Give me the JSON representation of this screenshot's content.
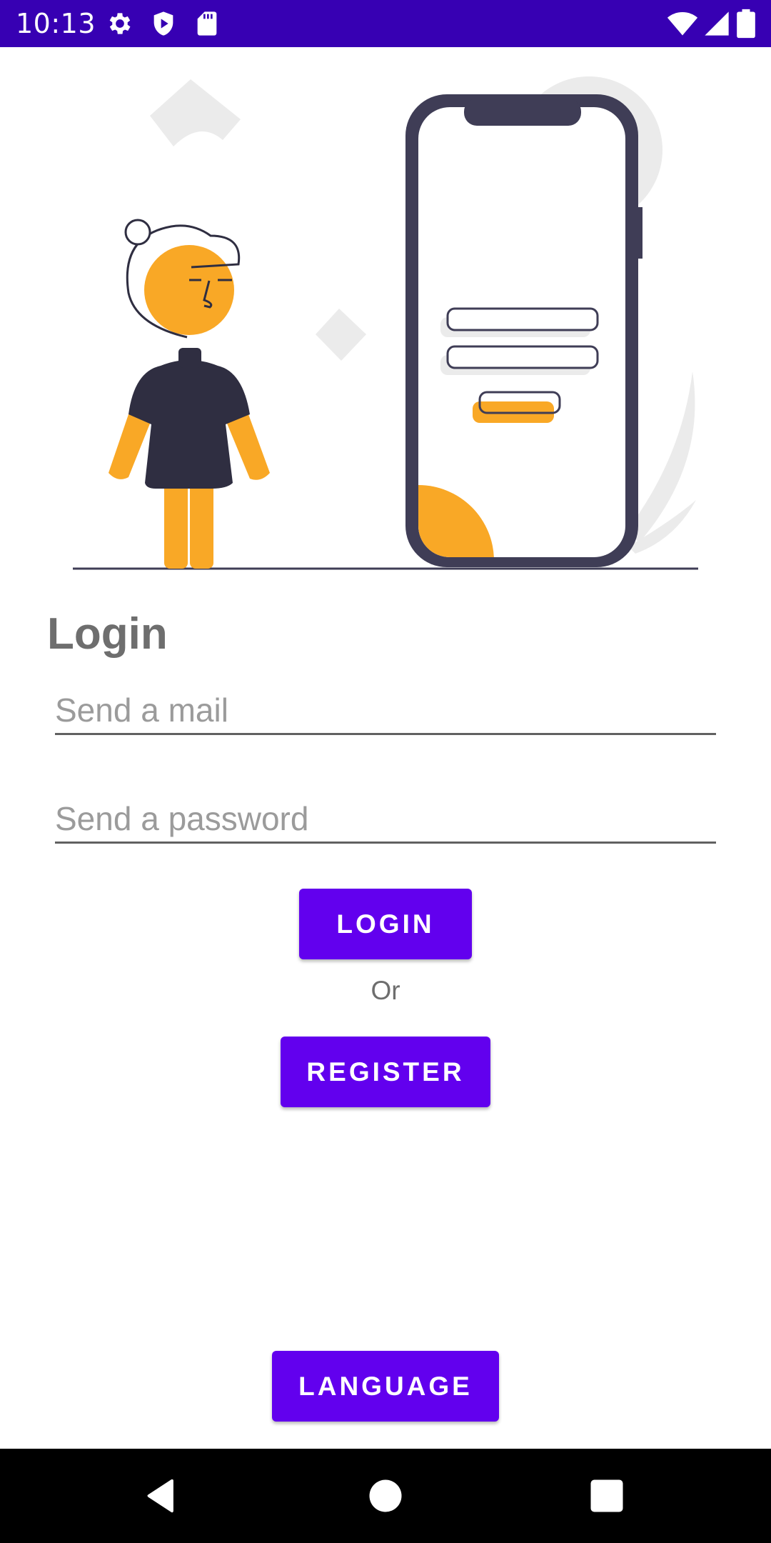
{
  "status_bar": {
    "time": "10:13",
    "icons_left": [
      "gear-icon",
      "shield-play-icon",
      "sd-card-icon"
    ],
    "icons_right": [
      "wifi-icon",
      "signal-icon",
      "battery-icon"
    ],
    "background": "#3700b3"
  },
  "illustration": {
    "description_icon": "login-illustration",
    "accent": "#f9a826",
    "dark": "#3f3d56"
  },
  "login": {
    "title": "Login",
    "email_placeholder": "Send a mail",
    "email_value": "",
    "password_placeholder": "Send a password",
    "password_value": "",
    "login_button": "LOGIN",
    "or_text": "Or",
    "register_button": "REGISTER"
  },
  "language_button": "LANGUAGE",
  "theme": {
    "primary": "#6200ee",
    "text_muted": "#6e6e6e"
  },
  "nav_bar": {
    "buttons": [
      "back-icon",
      "home-icon",
      "recents-icon"
    ]
  }
}
